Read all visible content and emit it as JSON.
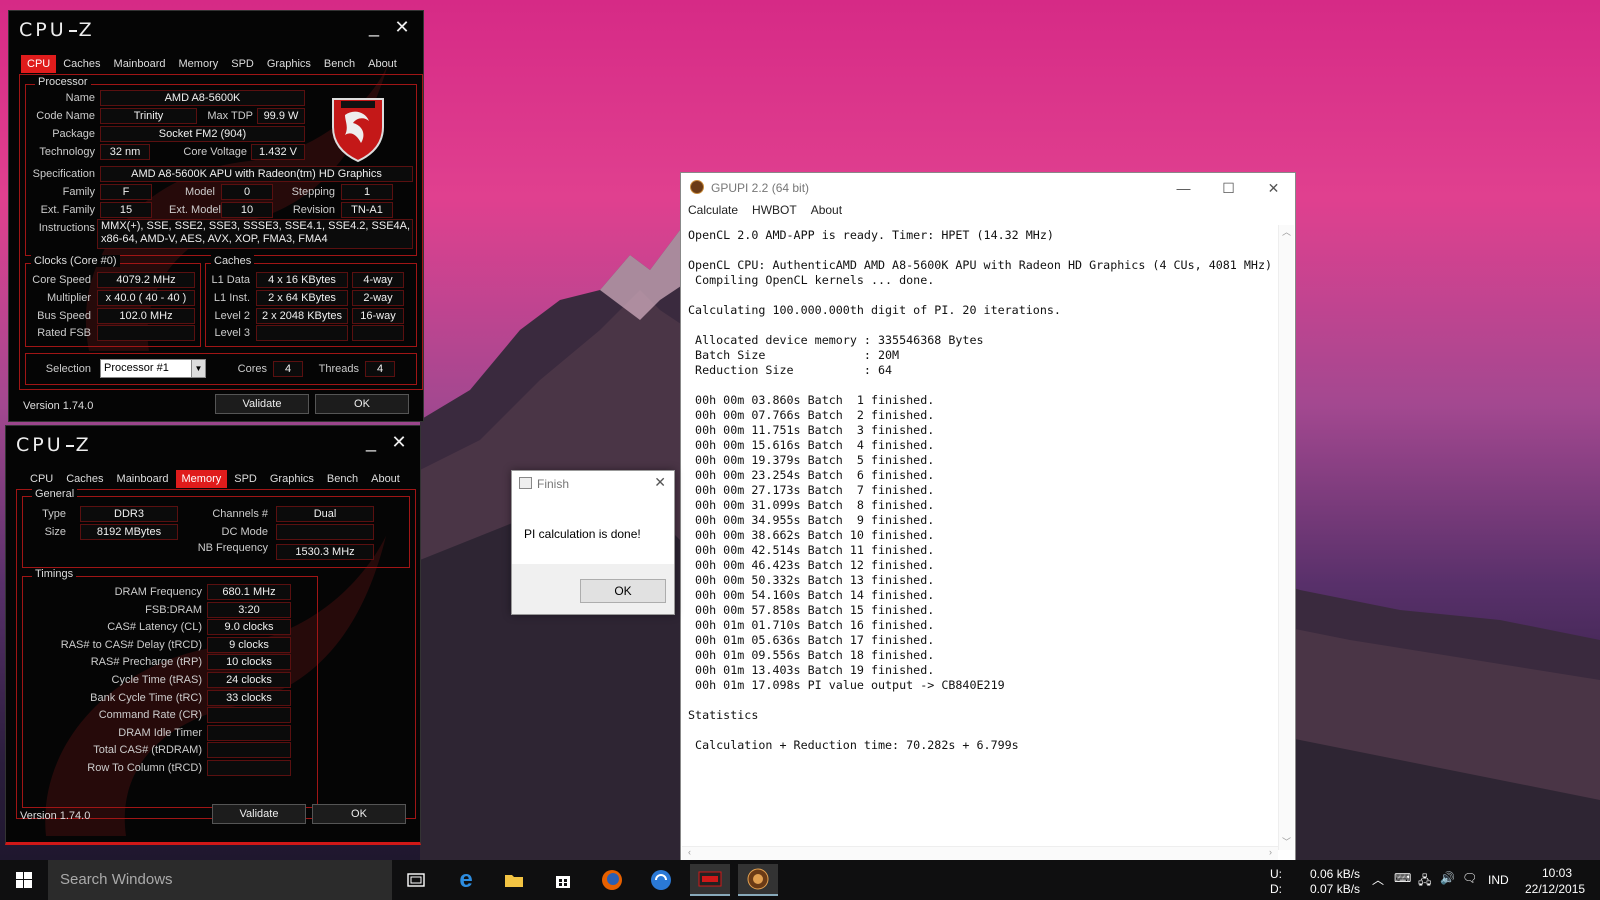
{
  "cpuz_top": {
    "title": "CPU-Z",
    "tabs": [
      "CPU",
      "Caches",
      "Mainboard",
      "Memory",
      "SPD",
      "Graphics",
      "Bench",
      "About"
    ],
    "active_tab": "CPU",
    "processor_group": "Processor",
    "name_label": "Name",
    "name": "AMD A8-5600K",
    "codename_label": "Code Name",
    "codename": "Trinity",
    "maxtdp_label": "Max TDP",
    "maxtdp": "99.9 W",
    "package_label": "Package",
    "package": "Socket FM2 (904)",
    "technology_label": "Technology",
    "technology": "32 nm",
    "corevoltage_label": "Core Voltage",
    "corevoltage": "1.432 V",
    "spec_label": "Specification",
    "spec": "AMD A8-5600K APU with Radeon(tm) HD Graphics",
    "family_label": "Family",
    "family": "F",
    "model_label": "Model",
    "model": "0",
    "stepping_label": "Stepping",
    "stepping": "1",
    "extfamily_label": "Ext. Family",
    "extfamily": "15",
    "extmodel_label": "Ext. Model",
    "extmodel": "10",
    "revision_label": "Revision",
    "revision": "TN-A1",
    "instructions_label": "Instructions",
    "instructions_1": "MMX(+), SSE, SSE2, SSE3, SSSE3, SSE4.1, SSE4.2, SSE4A,",
    "instructions_2": "x86-64, AMD-V, AES, AVX, XOP, FMA3, FMA4",
    "clocks_group": "Clocks (Core #0)",
    "corespeed_label": "Core Speed",
    "corespeed": "4079.2 MHz",
    "multiplier_label": "Multiplier",
    "multiplier": "x 40.0 ( 40 - 40 )",
    "busspeed_label": "Bus Speed",
    "busspeed": "102.0 MHz",
    "ratedfsb_label": "Rated FSB",
    "caches_group": "Caches",
    "l1data_label": "L1 Data",
    "l1data": "4 x 16 KBytes",
    "l1data_way": "4-way",
    "l1inst_label": "L1 Inst.",
    "l1inst": "2 x 64 KBytes",
    "l1inst_way": "2-way",
    "level2_label": "Level 2",
    "level2": "2 x 2048 KBytes",
    "level2_way": "16-way",
    "level3_label": "Level 3",
    "selection_label": "Selection",
    "selection": "Processor #1",
    "cores_label": "Cores",
    "cores": "4",
    "threads_label": "Threads",
    "threads": "4",
    "version": "Version 1.74.0",
    "validate": "Validate",
    "ok": "OK"
  },
  "cpuz_bottom": {
    "title": "CPU-Z",
    "tabs": [
      "CPU",
      "Caches",
      "Mainboard",
      "Memory",
      "SPD",
      "Graphics",
      "Bench",
      "About"
    ],
    "active_tab": "Memory",
    "general_group": "General",
    "type_label": "Type",
    "type": "DDR3",
    "size_label": "Size",
    "size": "8192 MBytes",
    "channels_label": "Channels #",
    "channels": "Dual",
    "dcmode_label": "DC Mode",
    "nbfreq_label": "NB Frequency",
    "nbfreq": "1530.3 MHz",
    "timings_group": "Timings",
    "timings": [
      {
        "label": "DRAM Frequency",
        "value": "680.1 MHz"
      },
      {
        "label": "FSB:DRAM",
        "value": "3:20"
      },
      {
        "label": "CAS# Latency (CL)",
        "value": "9.0 clocks"
      },
      {
        "label": "RAS# to CAS# Delay (tRCD)",
        "value": "9 clocks"
      },
      {
        "label": "RAS# Precharge (tRP)",
        "value": "10 clocks"
      },
      {
        "label": "Cycle Time (tRAS)",
        "value": "24 clocks"
      },
      {
        "label": "Bank Cycle Time (tRC)",
        "value": "33 clocks"
      },
      {
        "label": "Command Rate (CR)",
        "value": ""
      },
      {
        "label": "DRAM Idle Timer",
        "value": ""
      },
      {
        "label": "Total CAS# (tRDRAM)",
        "value": ""
      },
      {
        "label": "Row To Column (tRCD)",
        "value": ""
      }
    ],
    "version": "Version 1.74.0",
    "validate": "Validate",
    "ok": "OK"
  },
  "gpupi": {
    "title": "GPUPI 2.2 (64 bit)",
    "menu": [
      "Calculate",
      "HWBOT",
      "About"
    ],
    "output": [
      "OpenCL 2.0 AMD-APP is ready. Timer: HPET (14.32 MHz)",
      "",
      "OpenCL CPU: AuthenticAMD AMD A8-5600K APU with Radeon HD Graphics (4 CUs, 4081 MHz)",
      " Compiling OpenCL kernels ... done.",
      "",
      "Calculating 100.000.000th digit of PI. 20 iterations.",
      "",
      " Allocated device memory : 335546368 Bytes",
      " Batch Size              : 20M",
      " Reduction Size          : 64",
      "",
      " 00h 00m 03.860s Batch  1 finished.",
      " 00h 00m 07.766s Batch  2 finished.",
      " 00h 00m 11.751s Batch  3 finished.",
      " 00h 00m 15.616s Batch  4 finished.",
      " 00h 00m 19.379s Batch  5 finished.",
      " 00h 00m 23.254s Batch  6 finished.",
      " 00h 00m 27.173s Batch  7 finished.",
      " 00h 00m 31.099s Batch  8 finished.",
      " 00h 00m 34.955s Batch  9 finished.",
      " 00h 00m 38.662s Batch 10 finished.",
      " 00h 00m 42.514s Batch 11 finished.",
      " 00h 00m 46.423s Batch 12 finished.",
      " 00h 00m 50.332s Batch 13 finished.",
      " 00h 00m 54.160s Batch 14 finished.",
      " 00h 00m 57.858s Batch 15 finished.",
      " 00h 01m 01.710s Batch 16 finished.",
      " 00h 01m 05.636s Batch 17 finished.",
      " 00h 01m 09.556s Batch 18 finished.",
      " 00h 01m 13.403s Batch 19 finished.",
      " 00h 01m 17.098s PI value output -> CB840E219",
      "",
      "Statistics",
      "",
      " Calculation + Reduction time: 70.282s + 6.799s"
    ]
  },
  "dialog": {
    "title": "Finish",
    "message": "PI calculation is done!",
    "ok": "OK"
  },
  "taskbar": {
    "search_placeholder": "Search Windows",
    "net_u": "U:",
    "net_d": "D:",
    "upload": "0.06 kB/s",
    "download": "0.07 kB/s",
    "language": "IND",
    "time": "10:03",
    "date": "22/12/2015"
  }
}
